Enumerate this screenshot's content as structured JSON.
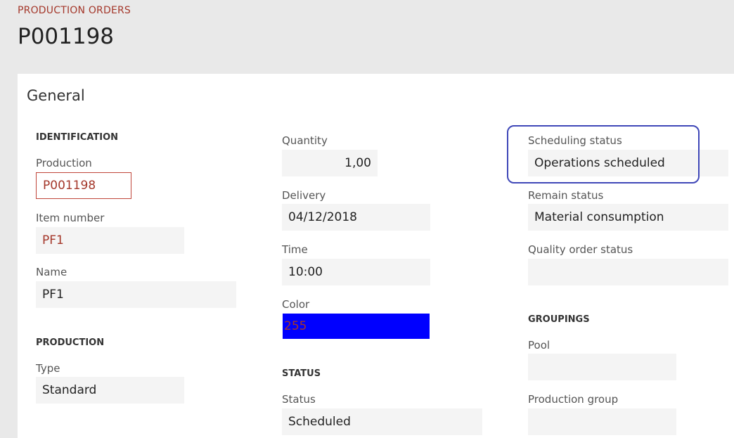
{
  "header": {
    "breadcrumb": "PRODUCTION ORDERS",
    "title": "P001198"
  },
  "panel": {
    "section_title": "General"
  },
  "identification": {
    "header": "IDENTIFICATION",
    "production_label": "Production",
    "production_value": "P001198",
    "item_number_label": "Item number",
    "item_number_value": "PF1",
    "name_label": "Name",
    "name_value": "PF1"
  },
  "production": {
    "header": "PRODUCTION",
    "type_label": "Type",
    "type_value": "Standard"
  },
  "details": {
    "quantity_label": "Quantity",
    "quantity_value": "1,00",
    "delivery_label": "Delivery",
    "delivery_value": "04/12/2018",
    "time_label": "Time",
    "time_value": "10:00",
    "color_label": "Color",
    "color_value": "255",
    "color_swatch": "#0000ff"
  },
  "status": {
    "header": "STATUS",
    "status_label": "Status",
    "status_value": "Scheduled"
  },
  "statuses": {
    "scheduling_label": "Scheduling status",
    "scheduling_value": "Operations scheduled",
    "remain_label": "Remain status",
    "remain_value": "Material consumption",
    "quality_label": "Quality order status",
    "quality_value": ""
  },
  "groupings": {
    "header": "GROUPINGS",
    "pool_label": "Pool",
    "pool_value": "",
    "production_group_label": "Production group",
    "production_group_value": ""
  },
  "colors": {
    "accent_red": "#a4372a",
    "highlight_blue": "#3f47b8"
  }
}
